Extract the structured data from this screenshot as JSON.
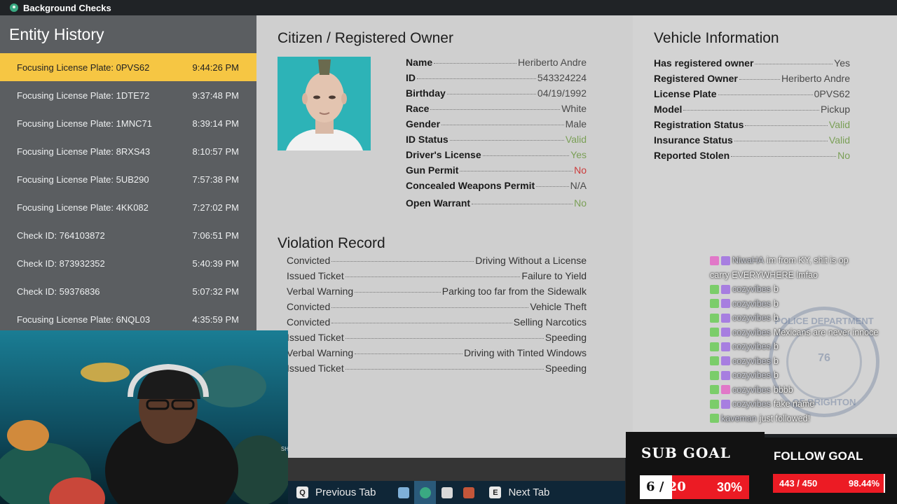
{
  "window": {
    "title": "Background Checks",
    "icon": "person-icon"
  },
  "history": {
    "heading": "Entity History",
    "items": [
      {
        "label": "Focusing License Plate: 0PVS62",
        "time": "9:44:26 PM"
      },
      {
        "label": "Focusing License Plate: 1DTE72",
        "time": "9:37:48 PM"
      },
      {
        "label": "Focusing License Plate: 1MNC71",
        "time": "8:39:14 PM"
      },
      {
        "label": "Focusing License Plate: 8RXS43",
        "time": "8:10:57 PM"
      },
      {
        "label": "Focusing License Plate: 5UB290",
        "time": "7:57:38 PM"
      },
      {
        "label": "Focusing License Plate: 4KK082",
        "time": "7:27:02 PM"
      },
      {
        "label": "Check ID: 764103872",
        "time": "7:06:51 PM"
      },
      {
        "label": "Check ID: 873932352",
        "time": "5:40:39 PM"
      },
      {
        "label": "Check ID: 59376836",
        "time": "5:07:32 PM"
      },
      {
        "label": "Focusing License Plate: 6NQL03",
        "time": "4:35:59 PM"
      }
    ]
  },
  "citizen": {
    "title": "Citizen / Registered Owner",
    "fields": [
      {
        "label": "Name",
        "value": "Heriberto Andre"
      },
      {
        "label": "ID",
        "value": "543324224"
      },
      {
        "label": "Birthday",
        "value": "04/19/1992"
      },
      {
        "label": "Race",
        "value": "White"
      },
      {
        "label": "Gender",
        "value": "Male"
      },
      {
        "label": "ID Status",
        "value": "Valid"
      },
      {
        "label": "Driver's License",
        "value": "Yes"
      },
      {
        "label": "Gun Permit",
        "value": "No"
      },
      {
        "label": "Concealed Weapons Permit",
        "value": "N/A"
      },
      {
        "label": "Open Warrant",
        "value": "No"
      }
    ]
  },
  "violations": {
    "title": "Violation Record",
    "items": [
      {
        "type": "Convicted",
        "offense": "Driving Without a License"
      },
      {
        "type": "Issued Ticket",
        "offense": "Failure to Yield"
      },
      {
        "type": "Verbal Warning",
        "offense": "Parking too far from the Sidewalk"
      },
      {
        "type": "Convicted",
        "offense": "Vehicle Theft"
      },
      {
        "type": "Convicted",
        "offense": "Selling Narcotics"
      },
      {
        "type": "Issued Ticket",
        "offense": "Speeding"
      },
      {
        "type": "Verbal Warning",
        "offense": "Driving with Tinted Windows"
      },
      {
        "type": "Issued Ticket",
        "offense": "Speeding"
      }
    ]
  },
  "vehicle": {
    "title": "Vehicle Information",
    "fields": [
      {
        "label": "Has registered owner",
        "value": "Yes"
      },
      {
        "label": "Registered Owner",
        "value": "Heriberto Andre"
      },
      {
        "label": "License Plate",
        "value": "0PVS62"
      },
      {
        "label": "Model",
        "value": "Pickup"
      },
      {
        "label": "Registration Status",
        "value": "Valid"
      },
      {
        "label": "Insurance Status",
        "value": "Valid"
      },
      {
        "label": "Reported Stolen",
        "value": "No"
      }
    ]
  },
  "tabs": {
    "prev_key": "Q",
    "prev_label": "Previous Tab",
    "next_key": "E",
    "next_label": "Next Tab",
    "icons": [
      "map-icon",
      "person-icon",
      "clipboard-icon",
      "book-icon"
    ]
  },
  "chat": {
    "messages": [
      {
        "user": "NiwaHA",
        "text": "im from KY, shit is op"
      },
      {
        "user": "",
        "text": "carry EVERYWHERE lmfao"
      },
      {
        "user": "cozyvibes",
        "text": "b"
      },
      {
        "user": "cozyvibes",
        "text": "b"
      },
      {
        "user": "cozyvibes",
        "text": "b"
      },
      {
        "user": "cozyvibes",
        "text": "Mexicans are never innoce"
      },
      {
        "user": "cozyvibes",
        "text": "b"
      },
      {
        "user": "cozyvibes",
        "text": "b"
      },
      {
        "user": "cozyvibes",
        "text": "b"
      },
      {
        "user": "cozyvibes",
        "text": "bbbb"
      },
      {
        "user": "cozyvibes",
        "text": "fake name"
      },
      {
        "user": "kaveman",
        "text": "just followed!"
      }
    ]
  },
  "seal": {
    "top": "POLICE DEPARTMENT",
    "bottom": "OF BRIGHTON",
    "number": "76"
  },
  "webcam": {
    "watermark": "SH"
  },
  "sub_goal": {
    "title": "SUB GOAL",
    "current": "6",
    "sep": "/",
    "target": "20",
    "percent": "30%",
    "fraction": 0.3
  },
  "follow_goal": {
    "title": "FOLLOW GOAL",
    "count": "443 / 450",
    "percent": "98.44%",
    "fraction": 0.9844
  }
}
